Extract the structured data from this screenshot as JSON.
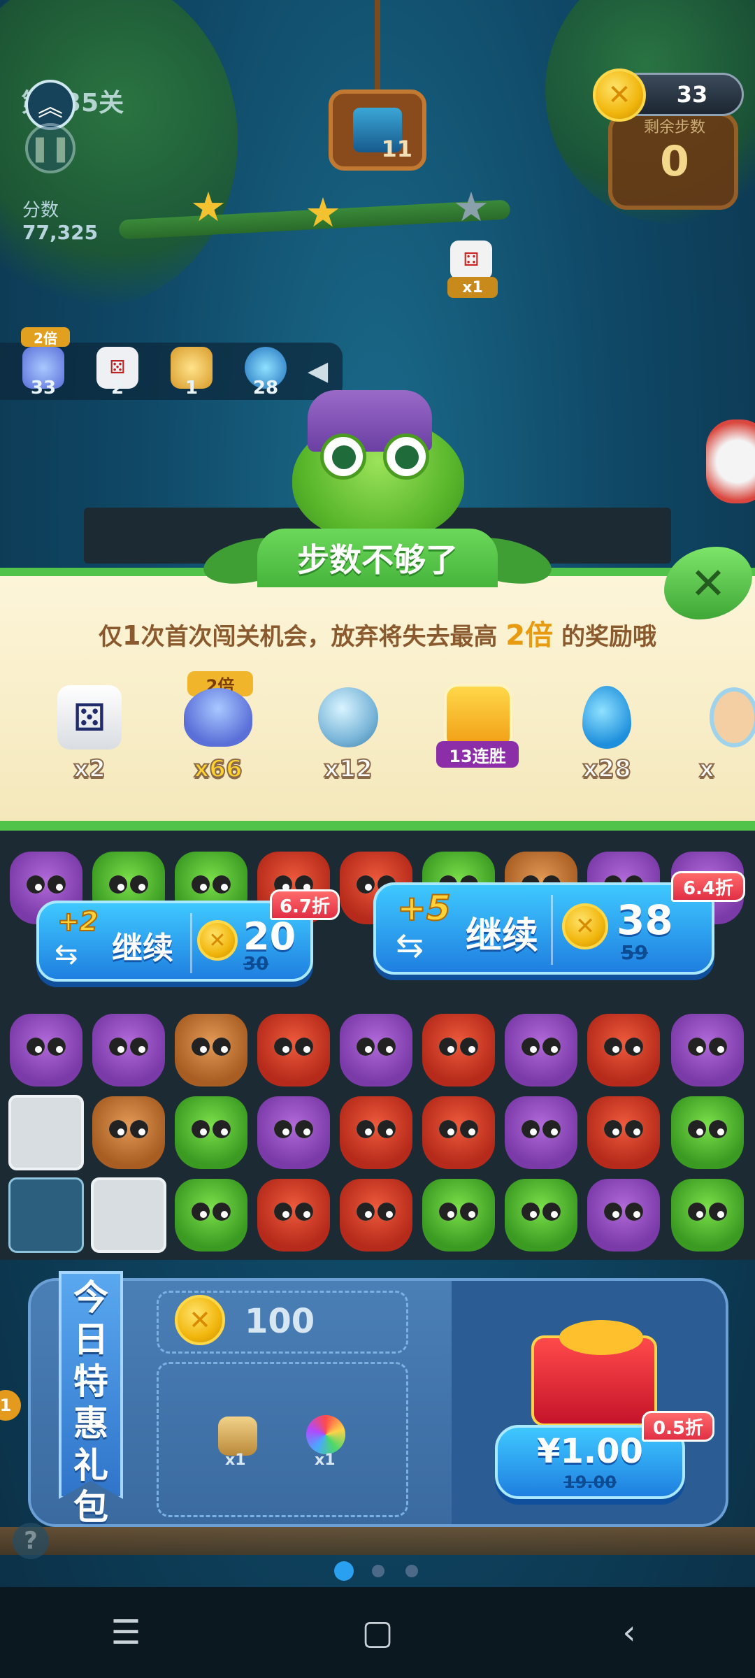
{
  "hud": {
    "level": "第435关",
    "score_label": "分数",
    "score_value": "77,325",
    "target_count": "11",
    "bonus_multiplier": "x1",
    "coins": "33",
    "moves_label": "剩余步数",
    "moves_left": "0"
  },
  "boosters": [
    {
      "icon": "bag-icon",
      "count": "33",
      "tag": "2倍"
    },
    {
      "icon": "dice-icon",
      "count": "2"
    },
    {
      "icon": "potion-icon",
      "count": "1"
    },
    {
      "icon": "water-drop-icon",
      "count": "28"
    }
  ],
  "dialog": {
    "title": "步数不够了",
    "message_pre": "仅",
    "message_num": "1",
    "message_mid": "次首次闯关机会，放弃将失去最高",
    "message_hl": "2倍",
    "message_post": "的奖励哦",
    "rewards": [
      {
        "icon": "dice-icon",
        "qty": "x2"
      },
      {
        "icon": "bag-icon",
        "qty": "x66",
        "tag": "2倍"
      },
      {
        "icon": "magic-orb-icon",
        "qty": "x12"
      },
      {
        "icon": "crown-trophy-icon",
        "tag": "13连胜"
      },
      {
        "icon": "water-drop-icon",
        "qty": "x28"
      },
      {
        "icon": "partial-item-icon",
        "qty": "x"
      }
    ]
  },
  "continue_options": [
    {
      "plus": "+2",
      "label": "继续",
      "price": "20",
      "old_price": "30",
      "discount": "6.7折"
    },
    {
      "plus": "+5",
      "label": "继续",
      "price": "38",
      "old_price": "59",
      "discount": "6.4折"
    }
  ],
  "daily_pack": {
    "title": "今日特惠礼包",
    "coin_amount": "100",
    "items": [
      {
        "icon": "hammer-icon",
        "qty": "x1"
      },
      {
        "icon": "rainbow-owl-icon",
        "qty": "x1"
      }
    ],
    "price": "¥1.00",
    "old_price": "19.00",
    "discount": "0.5折"
  },
  "left_badge": "1",
  "help": "?",
  "pager": {
    "pages": 3,
    "active": 0
  },
  "colors": {
    "dialog_green": "#51c24a",
    "button_blue": "#1f7fe0",
    "discount_red": "#e12f45",
    "gold": "#f2c230"
  }
}
